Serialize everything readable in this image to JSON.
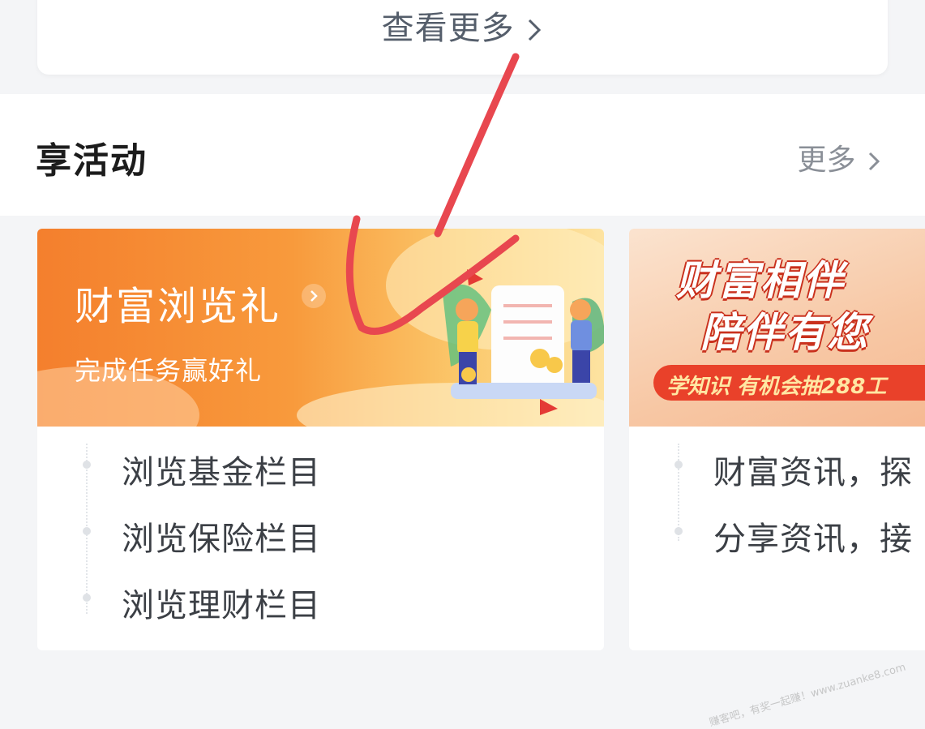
{
  "top_card": {
    "view_more": "查看更多"
  },
  "section": {
    "title": "享活动",
    "more": "更多"
  },
  "cards": [
    {
      "banner_title": "财富浏览礼",
      "banner_subtitle": "完成任务赢好礼",
      "tasks": [
        "浏览基金栏目",
        "浏览保险栏目",
        "浏览理财栏目"
      ]
    },
    {
      "banner_line1": "财富相伴",
      "banner_line2": "陪伴有您",
      "banner_strip": "学知识 有机会抽288工",
      "tasks": [
        "财富资讯，探",
        "分享资讯，接"
      ]
    }
  ],
  "colors": {
    "annotation_red": "#e8474f",
    "banner_orange": "#f47f2d"
  },
  "watermark": "赚客吧，有奖一起赚！www.zuanke8.com"
}
